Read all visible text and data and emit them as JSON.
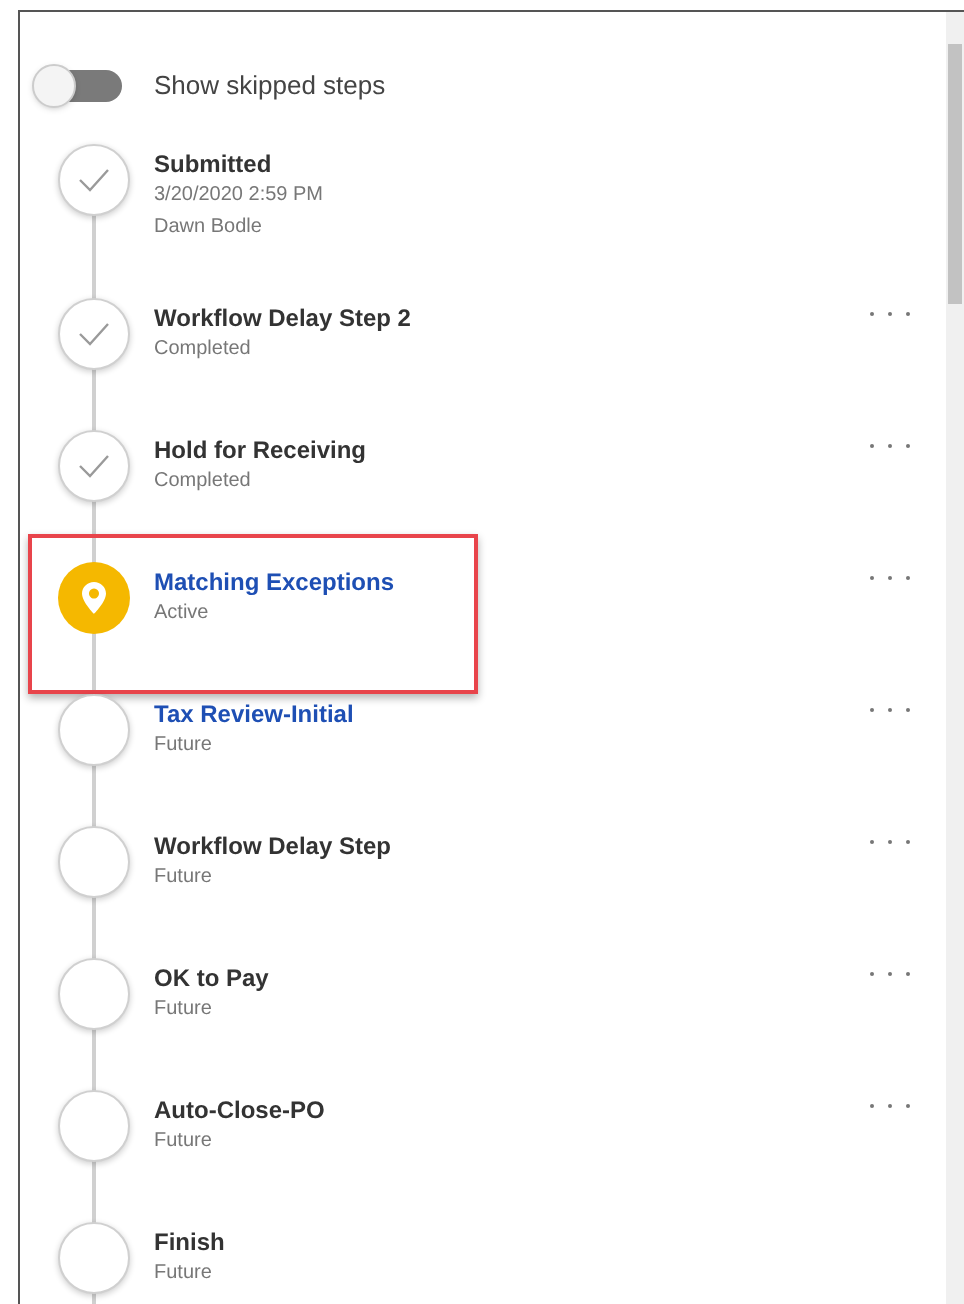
{
  "toggle": {
    "label": "Show skipped steps",
    "on": false
  },
  "steps": [
    {
      "kind": "completed",
      "title": "Submitted",
      "lines": [
        "3/20/2020 2:59 PM",
        "Dawn Bodle"
      ],
      "link": false,
      "menu": false,
      "highlighted": false
    },
    {
      "kind": "completed",
      "title": "Workflow Delay Step 2",
      "lines": [
        "Completed"
      ],
      "link": false,
      "menu": true,
      "highlighted": false
    },
    {
      "kind": "completed",
      "title": "Hold for Receiving",
      "lines": [
        "Completed"
      ],
      "link": false,
      "menu": true,
      "highlighted": false
    },
    {
      "kind": "active",
      "title": "Matching Exceptions",
      "lines": [
        "Active"
      ],
      "link": true,
      "menu": true,
      "highlighted": true
    },
    {
      "kind": "future",
      "title": "Tax Review-Initial",
      "lines": [
        "Future"
      ],
      "link": true,
      "menu": true,
      "highlighted": false
    },
    {
      "kind": "future",
      "title": "Workflow Delay Step",
      "lines": [
        "Future"
      ],
      "link": false,
      "menu": true,
      "highlighted": false
    },
    {
      "kind": "future",
      "title": "OK to Pay",
      "lines": [
        "Future"
      ],
      "link": false,
      "menu": true,
      "highlighted": false
    },
    {
      "kind": "future",
      "title": "Auto-Close-PO",
      "lines": [
        "Future"
      ],
      "link": false,
      "menu": true,
      "highlighted": false
    },
    {
      "kind": "future",
      "title": "Finish",
      "lines": [
        "Future"
      ],
      "link": false,
      "menu": false,
      "highlighted": false
    }
  ]
}
